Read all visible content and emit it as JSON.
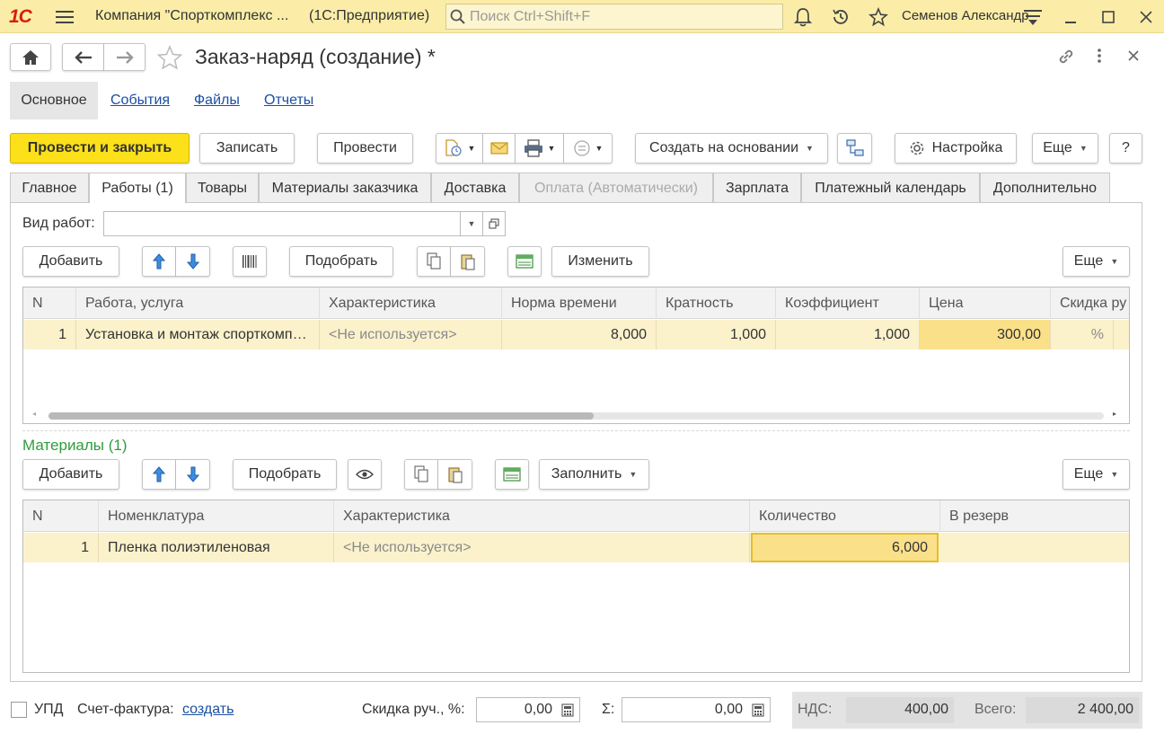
{
  "titlebar": {
    "logo": "1С",
    "company": "Компания \"Спорткомплекс ...",
    "app": "(1С:Предприятие)",
    "search_placeholder": "Поиск Ctrl+Shift+F",
    "user": "Семенов Александр"
  },
  "nav": {
    "title": "Заказ-наряд (создание) *"
  },
  "sections": [
    {
      "label": "Основное"
    },
    {
      "label": "События"
    },
    {
      "label": "Файлы"
    },
    {
      "label": "Отчеты"
    }
  ],
  "toolbar": {
    "post_close": "Провести и закрыть",
    "save": "Записать",
    "post": "Провести",
    "create_based": "Создать на основании",
    "settings": "Настройка",
    "more": "Еще",
    "help": "?"
  },
  "tabs": [
    {
      "label": "Главное"
    },
    {
      "label": "Работы (1)"
    },
    {
      "label": "Товары"
    },
    {
      "label": "Материалы заказчика"
    },
    {
      "label": "Доставка"
    },
    {
      "label": "Оплата (Автоматически)"
    },
    {
      "label": "Зарплата"
    },
    {
      "label": "Платежный календарь"
    },
    {
      "label": "Дополнительно"
    }
  ],
  "works": {
    "type_label": "Вид работ:",
    "type_value": "",
    "add": "Добавить",
    "pick": "Подобрать",
    "change": "Изменить",
    "more": "Еще",
    "columns": [
      "N",
      "Работа, услуга",
      "Характеристика",
      "Норма времени",
      "Кратность",
      "Коэффициент",
      "Цена",
      "Скидка ру"
    ],
    "rows": [
      {
        "n": "1",
        "work": "Установка и монтаж спорткомплекса",
        "characteristic": "<Не используется>",
        "norm": "8,000",
        "multiplicity": "1,000",
        "coefficient": "1,000",
        "price": "300,00",
        "discount": "%"
      }
    ]
  },
  "materials": {
    "title": "Материалы (1)",
    "add": "Добавить",
    "pick": "Подобрать",
    "fill": "Заполнить",
    "more": "Еще",
    "columns": [
      "N",
      "Номенклатура",
      "Характеристика",
      "Количество",
      "В резерв"
    ],
    "rows": [
      {
        "n": "1",
        "item": "Пленка полиэтиленовая",
        "characteristic": "<Не используется>",
        "quantity": "6,000",
        "reserve": ""
      }
    ]
  },
  "footer": {
    "upd": "УПД",
    "invoice_label": "Счет-фактура:",
    "invoice_link": "создать",
    "discount_label": "Скидка руч., %:",
    "discount_value": "0,00",
    "sum_label": "Σ:",
    "sum_value": "0,00",
    "vat_label": "НДС:",
    "vat_value": "400,00",
    "total_label": "Всего:",
    "total_value": "2 400,00"
  }
}
